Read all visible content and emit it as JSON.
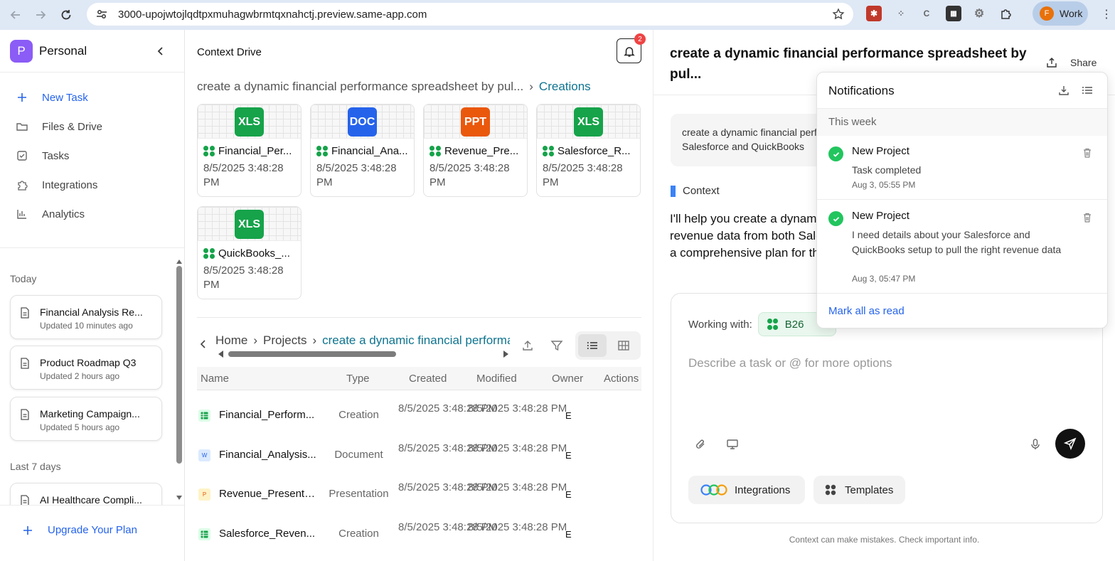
{
  "browser": {
    "url": "3000-upojwtojlqdtpxmuhagwbrmtqxnahctj.preview.same-app.com",
    "profile_label": "Work",
    "profile_initial": "F"
  },
  "sidebar": {
    "workspace_initial": "P",
    "workspace_name": "Personal",
    "nav": [
      {
        "label": "New Task",
        "icon": "plus-icon"
      },
      {
        "label": "Files & Drive",
        "icon": "folder-icon"
      },
      {
        "label": "Tasks",
        "icon": "checkbox-icon"
      },
      {
        "label": "Integrations",
        "icon": "puzzle-icon"
      },
      {
        "label": "Analytics",
        "icon": "bar-chart-icon"
      }
    ],
    "today_label": "Today",
    "recent": [
      {
        "title": "Financial Analysis Re...",
        "updated": "Updated 10 minutes ago"
      },
      {
        "title": "Product Roadmap Q3",
        "updated": "Updated 2 hours ago"
      },
      {
        "title": "Marketing Campaign...",
        "updated": "Updated 5 hours ago"
      }
    ],
    "last7_label": "Last 7 days",
    "last7": [
      {
        "title": "AI Healthcare Compli..."
      }
    ],
    "upgrade_label": "Upgrade Your Plan"
  },
  "drive": {
    "title": "Context Drive",
    "notification_count": "2",
    "breadcrumb_parent": "create a dynamic financial performance spreadsheet by pul...",
    "breadcrumb_current": "Creations",
    "files": [
      {
        "tag": "XLS",
        "tag_color": "#16a34a",
        "name": "Financial_Per...",
        "date": "8/5/2025 3:48:28 PM"
      },
      {
        "tag": "DOC",
        "tag_color": "#2563eb",
        "name": "Financial_Ana...",
        "date": "8/5/2025 3:48:28 PM"
      },
      {
        "tag": "PPT",
        "tag_color": "#ea580c",
        "name": "Revenue_Pre...",
        "date": "8/5/2025 3:48:28 PM"
      },
      {
        "tag": "XLS",
        "tag_color": "#16a34a",
        "name": "Salesforce_R...",
        "date": "8/5/2025 3:48:28 PM"
      },
      {
        "tag": "XLS",
        "tag_color": "#16a34a",
        "name": "QuickBooks_...",
        "date": "8/5/2025 3:48:28 PM"
      }
    ],
    "path": {
      "home": "Home",
      "projects": "Projects",
      "current": "create a dynamic financial performance spreadsheet by pulling"
    },
    "columns": [
      "Name",
      "Type",
      "Created",
      "Modified",
      "Owner",
      "Actions"
    ],
    "rows": [
      {
        "name": "Financial_Perform...",
        "type": "Creation",
        "created": "8/5/2025 3:48:28 PM",
        "modified": "8/5/2025 3:48:28 PM",
        "owner": "E",
        "icon_bg": "#dcfce7",
        "icon_color": "#16a34a",
        "icon_glyph": ""
      },
      {
        "name": "Financial_Analysis...",
        "type": "Document",
        "created": "8/5/2025 3:48:28 PM",
        "modified": "8/5/2025 3:48:28 PM",
        "owner": "E",
        "icon_bg": "#dbeafe",
        "icon_color": "#2563eb",
        "icon_glyph": "W"
      },
      {
        "name": "Revenue_Presenta...",
        "type": "Presentation",
        "created": "8/5/2025 3:48:28 PM",
        "modified": "8/5/2025 3:48:28 PM",
        "owner": "E",
        "icon_bg": "#fef3c7",
        "icon_color": "#ea580c",
        "icon_glyph": "P"
      },
      {
        "name": "Salesforce_Reven...",
        "type": "Creation",
        "created": "8/5/2025 3:48:28 PM",
        "modified": "8/5/2025 3:48:28 PM",
        "owner": "E",
        "icon_bg": "#dcfce7",
        "icon_color": "#16a34a",
        "icon_glyph": ""
      }
    ]
  },
  "chat": {
    "title": "create a dynamic financial performance spreadsheet by pul...",
    "share_label": "Share",
    "user_message": "create a dynamic financial performance spreadsheet by pulling revenue data from both Salesforce and QuickBooks",
    "context_label": "Context",
    "assistant_message": "I'll help you create a dynamic financial performance spreadsheet by pulling revenue data from both Salesforce and QuickBooks. Let me start by creating a comprehensive plan for this task.",
    "working_with_label": "Working with:",
    "working_chip": "B26",
    "input_placeholder": "Describe a task or @ for more options",
    "integrations_label": "Integrations",
    "templates_label": "Templates",
    "disclaimer": "Context can make mistakes. Check important info."
  },
  "notifications": {
    "title": "Notifications",
    "group_label": "This week",
    "items": [
      {
        "title": "New Project",
        "message": "Task completed",
        "time": "Aug 3, 05:55 PM"
      },
      {
        "title": "New Project",
        "message": "I need details about your Salesforce and QuickBooks setup to pull the right revenue data",
        "time": "Aug 3, 05:47 PM"
      }
    ],
    "mark_all_label": "Mark all as read"
  }
}
